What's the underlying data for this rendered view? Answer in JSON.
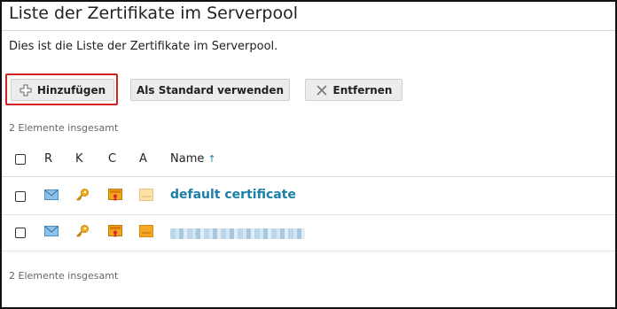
{
  "page": {
    "title": "Liste der Zertifikate im Serverpool",
    "description": "Dies ist die Liste der Zertifikate im Serverpool."
  },
  "toolbar": {
    "add_label": "Hinzufügen",
    "set_default_label": "Als Standard verwenden",
    "remove_label": "Entfernen"
  },
  "summary": {
    "top": "2 Elemente insgesamt",
    "bottom": "2 Elemente insgesamt"
  },
  "table": {
    "columns": [
      "R",
      "K",
      "C",
      "A",
      "Name"
    ],
    "sort_indicator": "↑",
    "rows": [
      {
        "name": "default certificate",
        "r_icon": "envelope-icon",
        "k_icon": "key-icon",
        "c_icon": "certificate-icon",
        "a_icon": "document-icon",
        "a_active": false
      },
      {
        "name": "",
        "r_icon": "envelope-icon",
        "k_icon": "key-icon",
        "c_icon": "certificate-icon",
        "a_icon": "document-icon",
        "a_active": true
      }
    ]
  },
  "colors": {
    "link": "#1a7fa8",
    "focus": "#d12222",
    "key": "#f0a020",
    "certificate": "#e69a18"
  }
}
